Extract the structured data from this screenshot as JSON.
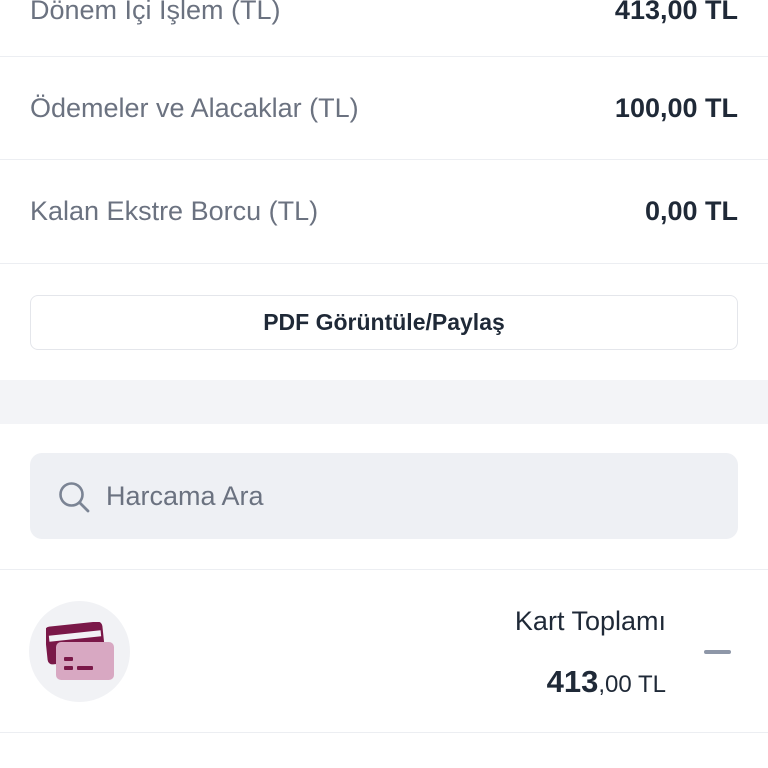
{
  "summary": {
    "rows": [
      {
        "label": "Dönem İçi İşlem (TL)",
        "value": "413,00 TL"
      },
      {
        "label": "Ödemeler ve Alacaklar (TL)",
        "value": "100,00 TL"
      },
      {
        "label": "Kalan Ekstre Borcu (TL)",
        "value": "0,00 TL"
      }
    ],
    "pdf_button_label": "PDF Görüntüle/Paylaş"
  },
  "search": {
    "placeholder": "Harcama Ara",
    "value": ""
  },
  "card_total": {
    "icon": "credit-cards-icon",
    "label": "Kart Toplamı",
    "amount_integer": "413",
    "amount_fraction": ",00 TL",
    "toggle_icon": "collapse-minus-icon"
  },
  "colors": {
    "card_icon_dark": "#7a1848",
    "card_icon_light": "#d8a8c2",
    "text_primary": "#1f2937",
    "text_secondary": "#6b7280",
    "search_bg": "#eef0f4",
    "band_bg": "#f3f4f7"
  }
}
